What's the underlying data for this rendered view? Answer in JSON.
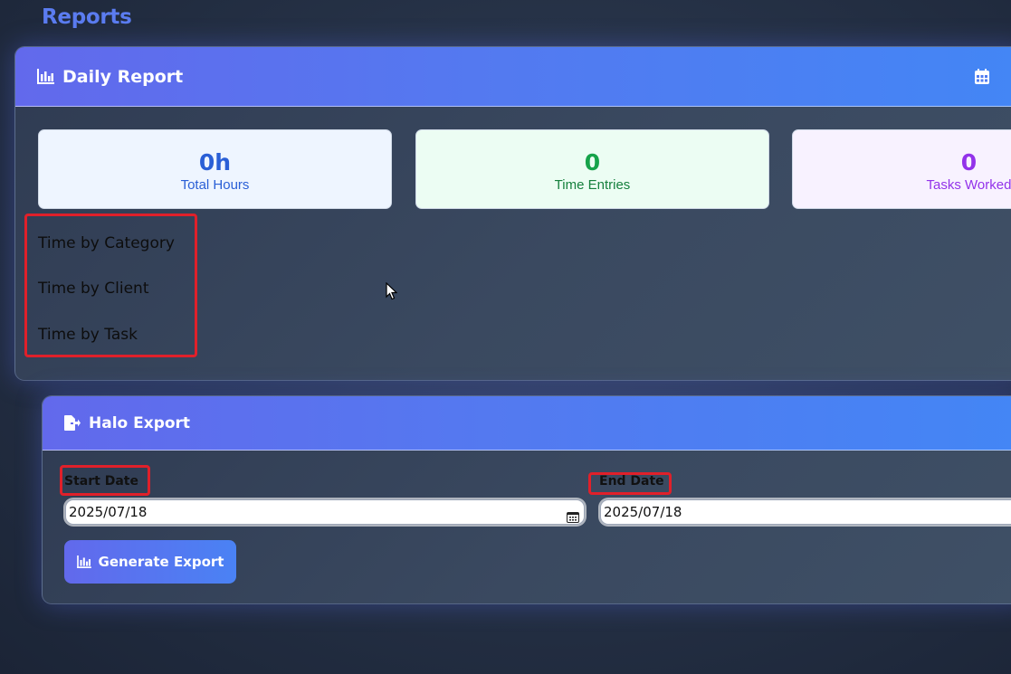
{
  "page": {
    "title": "Reports"
  },
  "daily_report": {
    "title": "Daily Report",
    "header_icon": "bar-chart-icon",
    "calendar_icon": "calendar-icon",
    "stats": [
      {
        "value": "0h",
        "label": "Total Hours",
        "color": "#2a5fd6"
      },
      {
        "value": "0",
        "label": "Time Entries",
        "color": "#16a34a"
      },
      {
        "value": "0",
        "label": "Tasks Worked",
        "color": "#9333ea"
      }
    ],
    "sections": [
      "Time by Category",
      "Time by Client",
      "Time by Task"
    ]
  },
  "halo_export": {
    "title": "Halo Export",
    "header_icon": "file-export-icon",
    "start_date": {
      "label": "Start Date",
      "value": "2025/07/18"
    },
    "end_date": {
      "label": "End Date",
      "value": "2025/07/18"
    },
    "generate_button": "Generate Export"
  },
  "colors": {
    "accent": "#5b7cf0",
    "highlight": "#e0202a"
  }
}
